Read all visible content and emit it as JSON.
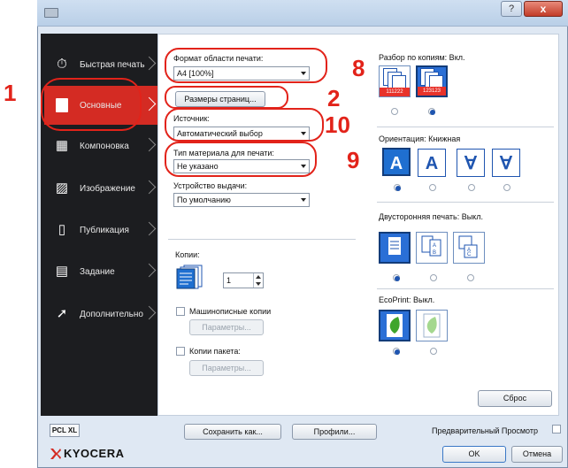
{
  "window": {
    "help_label": "?",
    "close_label": "x"
  },
  "callouts": {
    "one": "1",
    "two": "2",
    "eight": "8",
    "nine": "9",
    "ten": "10"
  },
  "nav": {
    "items": [
      {
        "label": "Быстрая печать",
        "icon": "stopwatch-icon",
        "active": false
      },
      {
        "label": "Основные",
        "icon": "page-icon",
        "active": true
      },
      {
        "label": "Компоновка",
        "icon": "layout-icon",
        "active": false
      },
      {
        "label": "Изображение",
        "icon": "image-icon",
        "active": false
      },
      {
        "label": "Публикация",
        "icon": "publish-icon",
        "active": false
      },
      {
        "label": "Задание",
        "icon": "job-icon",
        "active": false
      },
      {
        "label": "Дополнительно",
        "icon": "advanced-arrow-icon",
        "active": false
      }
    ]
  },
  "basic": {
    "print_size_label": "Формат области печати:",
    "print_size_value": "A4  [100%]",
    "page_sizes_button": "Размеры страниц...",
    "source_label": "Источник:",
    "source_value": "Автоматический выбор",
    "media_type_label": "Тип материала для печати:",
    "media_type_value": "Не указано",
    "output_label": "Устройство выдачи:",
    "output_value": "По умолчанию",
    "copies_label": "Копии:",
    "copies_value": "1",
    "typewriter_copies_label": "Машинописные копии",
    "typewriter_params_button": "Параметры...",
    "batch_copies_label": "Копии пакета:",
    "batch_params_button": "Параметры..."
  },
  "right": {
    "collate_label": "Разбор по копиям:  Вкл.",
    "orientation_label": "Ориентация:  Книжная",
    "orientation_glyphs": [
      "A",
      "A",
      "∀",
      "∀"
    ],
    "duplex_label": "Двусторонняя печать:  Выкл.",
    "ecoprint_label": "EcoPrint:  Выкл.",
    "reset_button": "Сброс"
  },
  "collate_pages": {
    "uncollated": "111222",
    "collated": "123123"
  },
  "footer": {
    "pcl_label": "PCL XL",
    "save_as_button": "Сохранить как...",
    "profiles_button": "Профили...",
    "preview_label": "Предварительный Просмотр",
    "ok_button": "OK",
    "cancel_button": "Отмена",
    "brand": "KYOCERA"
  },
  "colors": {
    "accent": "#d42b23",
    "selection": "#1f6fd0",
    "callout": "#e2231a",
    "nav_bg": "#1c1d20"
  }
}
